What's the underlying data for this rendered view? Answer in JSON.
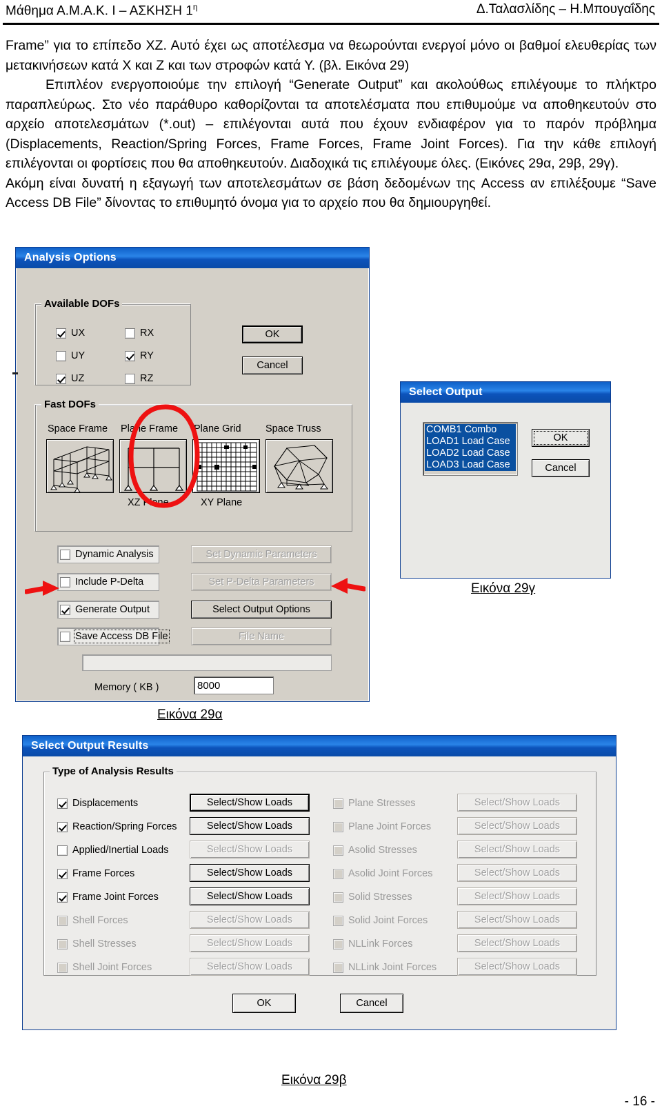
{
  "header": {
    "left_main": "Μάθημα Α.Μ.Α.Κ. Ι – ΑΣΚΗΣΗ 1",
    "left_sup": "η",
    "right": "Δ.Ταλασλίδης – Η.Μπουγαΐδης"
  },
  "body": {
    "p1": "Frame” για το επίπεδο ΧΖ. Αυτό έχει ως αποτέλεσμα να θεωρούνται ενεργοί μόνο οι βαθμοί ελευθερίας των μετακινήσεων κατά Χ και Ζ και των στροφών κατά Υ. (βλ. Εικόνα 29)",
    "p2": "Επιπλέον ενεργοποιούμε την επιλογή “Generate Output” και ακολούθως επιλέγουμε το πλήκτρο παραπλεύρως. Στο νέο παράθυρο καθορίζονται τα αποτελέσματα που επιθυμούμε να αποθηκευτούν στο αρχείο αποτελεσμάτων (*.out) – επιλέγονται αυτά που έχουν ενδιαφέρον για το παρόν πρόβλημα (Displacements, Reaction/Spring Forces, Frame Forces, Frame Joint Forces). Για την κάθε επιλογή επιλέγονται οι φορτίσεις που θα αποθηκευτούν. Διαδοχικά τις επιλέγουμε όλες. (Εικόνες 29α, 29β, 29γ).",
    "p3": "Ακόμη είναι δυνατή η εξαγωγή των αποτελεσμάτων σε βάση δεδομένων της Access αν επιλέξουμε “Save Access DB File” δίνοντας το επιθυμητό όνομα για το αρχείο που θα δημιουργηθεί."
  },
  "analysis_options": {
    "title": "Analysis Options",
    "available_dofs": {
      "legend": "Available DOFs",
      "items": [
        {
          "label": "UX",
          "checked": true
        },
        {
          "label": "RX",
          "checked": false
        },
        {
          "label": "UY",
          "checked": false
        },
        {
          "label": "RY",
          "checked": true
        },
        {
          "label": "UZ",
          "checked": true
        },
        {
          "label": "RZ",
          "checked": false
        }
      ]
    },
    "ok_label": "OK",
    "cancel_label": "Cancel",
    "fast_dofs": {
      "legend": "Fast DOFs",
      "items": [
        {
          "label": "Space Frame",
          "sublabel": "",
          "icon": "space-frame-icon"
        },
        {
          "label": "Plane Frame",
          "sublabel": "XZ Plane",
          "icon": "plane-frame-icon"
        },
        {
          "label": "Plane Grid",
          "sublabel": "XY Plane",
          "icon": "plane-grid-icon"
        },
        {
          "label": "Space Truss",
          "sublabel": "",
          "icon": "space-truss-icon"
        }
      ],
      "highlighted": "Plane Frame"
    },
    "options": [
      {
        "label": "Dynamic Analysis",
        "checked": false,
        "button": "Set Dynamic Parameters",
        "button_enabled": false
      },
      {
        "label": "Include P-Delta",
        "checked": false,
        "button": "Set P-Delta Parameters",
        "button_enabled": false
      },
      {
        "label": "Generate  Output",
        "checked": true,
        "button": "Select Output Options",
        "button_enabled": true
      },
      {
        "label": "Save Access DB File",
        "checked": false,
        "button": "File Name",
        "button_enabled": false
      }
    ],
    "file_name_value": "",
    "memory_label": "Memory ( KB )",
    "memory_value": "8000"
  },
  "select_output": {
    "title": "Select Output",
    "items": [
      {
        "label": "COMB1 Combo",
        "selected": true
      },
      {
        "label": "LOAD1 Load Case",
        "selected": true
      },
      {
        "label": "LOAD2 Load Case",
        "selected": true
      },
      {
        "label": "LOAD3 Load Case",
        "selected": true
      }
    ],
    "ok_label": "OK",
    "cancel_label": "Cancel"
  },
  "select_output_results": {
    "title": "Select Output Results",
    "legend": "Type of Analysis Results",
    "button_label": "Select/Show Loads",
    "left_rows": [
      {
        "label": "Displacements",
        "checked": true,
        "enabled": true,
        "default_button": true
      },
      {
        "label": "Reaction/Spring Forces",
        "checked": true,
        "enabled": true,
        "default_button": false
      },
      {
        "label": "Applied/Inertial Loads",
        "checked": false,
        "enabled": true,
        "button_enabled": false
      },
      {
        "label": "Frame Forces",
        "checked": true,
        "enabled": true,
        "default_button": false
      },
      {
        "label": "Frame Joint Forces",
        "checked": true,
        "enabled": true,
        "default_button": false
      },
      {
        "label": "Shell Forces",
        "checked": false,
        "enabled": false,
        "button_enabled": false
      },
      {
        "label": "Shell Stresses",
        "checked": false,
        "enabled": false,
        "button_enabled": false
      },
      {
        "label": "Shell Joint Forces",
        "checked": false,
        "enabled": false,
        "button_enabled": false
      }
    ],
    "right_rows": [
      {
        "label": "Plane Stresses",
        "checked": false,
        "enabled": false,
        "button_enabled": false
      },
      {
        "label": "Plane Joint Forces",
        "checked": false,
        "enabled": false,
        "button_enabled": false
      },
      {
        "label": "Asolid Stresses",
        "checked": false,
        "enabled": false,
        "button_enabled": false
      },
      {
        "label": "Asolid Joint Forces",
        "checked": false,
        "enabled": false,
        "button_enabled": false
      },
      {
        "label": "Solid Stresses",
        "checked": false,
        "enabled": false,
        "button_enabled": false
      },
      {
        "label": "Solid Joint Forces",
        "checked": false,
        "enabled": false,
        "button_enabled": false
      },
      {
        "label": "NLLink Forces",
        "checked": false,
        "enabled": false,
        "button_enabled": false
      },
      {
        "label": "NLLink Joint Forces",
        "checked": false,
        "enabled": false,
        "button_enabled": false
      }
    ],
    "ok_label": "OK",
    "cancel_label": "Cancel"
  },
  "captions": {
    "fig_29a": "Εικόνα 29α",
    "fig_29b": "Εικόνα 29β",
    "fig_29c": "Εικόνα 29γ"
  },
  "footer": {
    "page_number": "- 16 -"
  },
  "colors": {
    "annotation_red": "#ee1111",
    "title_bar_blue": "#0f60c8",
    "dialog_face": "#d4d0c8",
    "selection_blue": "#0a50a0"
  }
}
